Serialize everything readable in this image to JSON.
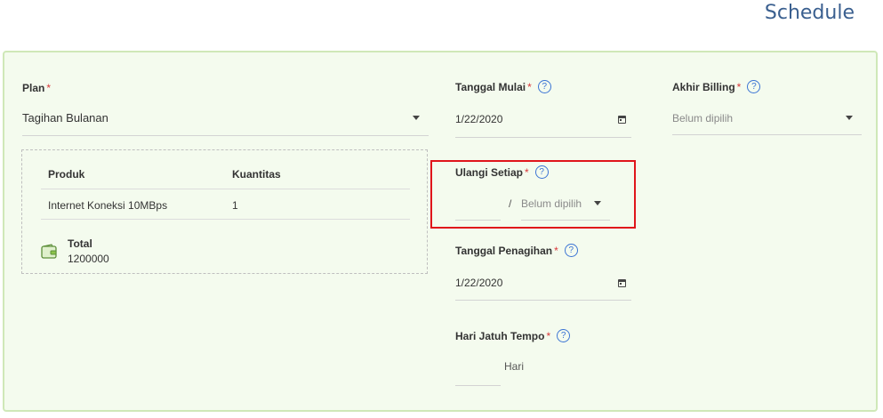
{
  "page_title": "Schedule",
  "plan": {
    "label": "Plan",
    "value": "Tagihan Bulanan"
  },
  "products": {
    "headers": [
      "Produk",
      "Kuantitas"
    ],
    "rows": [
      {
        "product": "Internet Koneksi 10MBps",
        "qty": "1"
      }
    ],
    "total_label": "Total",
    "total_value": "1200000"
  },
  "tanggal_mulai": {
    "label": "Tanggal Mulai",
    "value": "1/22/2020"
  },
  "ulangi_setiap": {
    "label": "Ulangi Setiap",
    "separator": "/",
    "unit_placeholder": "Belum dipilih"
  },
  "tanggal_penagihan": {
    "label": "Tanggal Penagihan",
    "value": "1/22/2020"
  },
  "hari_jatuh_tempo": {
    "label": "Hari Jatuh Tempo",
    "suffix": "Hari"
  },
  "akhir_billing": {
    "label": "Akhir Billing",
    "placeholder": "Belum dipilih"
  },
  "required_mark": "*",
  "help_mark": "?",
  "colors": {
    "title": "#3a5f8f",
    "panel_bg": "#f4fbee",
    "panel_border": "#cfe8b8",
    "required": "#d9383a",
    "help": "#3b74d4",
    "highlight": "#e0151b",
    "wallet": "#8bc34a"
  }
}
